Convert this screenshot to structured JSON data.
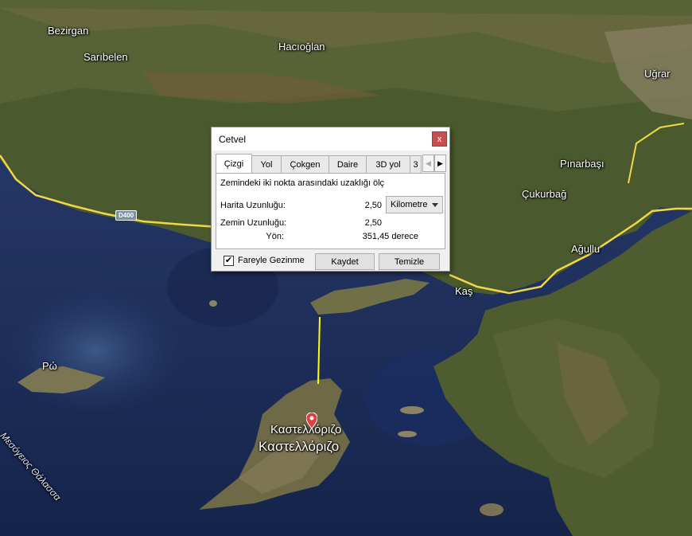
{
  "map": {
    "labels": {
      "bezirgan": "Bezirgan",
      "saribelen": "Sarıbelen",
      "hacioglan": "Hacıoğlan",
      "ugrar": "Uğrar",
      "pinarbasi": "Pınarbaşı",
      "cukurbag": "Çukurbağ",
      "agullu": "Ağullu",
      "kas": "Kaş",
      "ro": "Ρώ",
      "kastellorizo_small": "Καστελλόριζο",
      "kastellorizo_big": "Καστελλόριζο",
      "sea": "Μεσόγειος Θάλασσα",
      "road": "D400"
    },
    "colors": {
      "sea": "#1d2e58",
      "land": "#4b5a2e",
      "road": "#f0d64a",
      "ruler_line": "#ffff00"
    }
  },
  "dialog": {
    "title": "Cetvel",
    "close_glyph": "x",
    "tabs": [
      "Çizgi",
      "Yol",
      "Çokgen",
      "Daire",
      "3D yol",
      "3"
    ],
    "active_tab": "Çizgi",
    "scroll_left": "◀",
    "scroll_right": "▶",
    "description": "Zemindeki iki nokta arasındaki uzaklığı ölç",
    "map_length_label": "Harita Uzunluğu:",
    "map_length_value": "2,50",
    "ground_length_label": "Zemin Uzunluğu:",
    "ground_length_value": "2,50",
    "heading_label": "Yön:",
    "heading_value": "351,45 derece",
    "unit": "Kilometre",
    "mouse_nav_checked": "✔",
    "mouse_nav_label": "Fareyle Gezinme",
    "save_label": "Kaydet",
    "clear_label": "Temizle"
  }
}
